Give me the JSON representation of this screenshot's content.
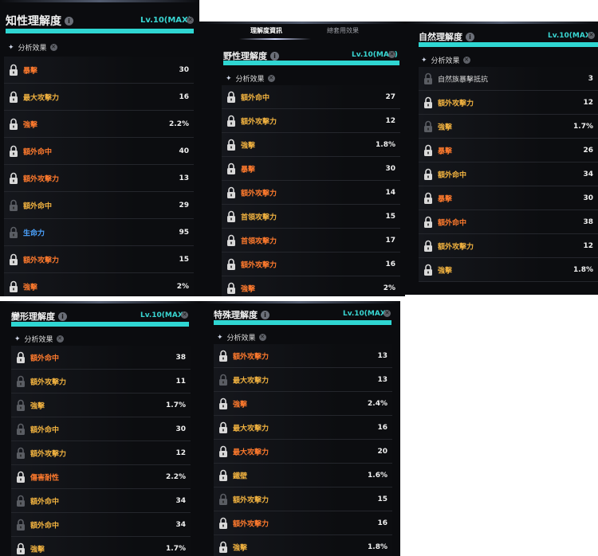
{
  "tabs": {
    "active": "理解度資訊",
    "inactive": "總套用效果"
  },
  "icons": {
    "lock": "lock-icon",
    "info": "info-icon",
    "close": "close-icon",
    "sparkle": "sparkle-icon"
  },
  "panels": [
    {
      "title": "知性理解度",
      "level": "Lv.10(MAX)",
      "subtitle": "分析效果",
      "rows": [
        {
          "label": "暴擊",
          "value": "30",
          "color": "orange",
          "unlocked": true
        },
        {
          "label": "最大攻擊力",
          "value": "16",
          "color": "yellow",
          "unlocked": true
        },
        {
          "label": "強擊",
          "value": "2.2%",
          "color": "orange",
          "unlocked": true
        },
        {
          "label": "額外命中",
          "value": "40",
          "color": "orange",
          "unlocked": true
        },
        {
          "label": "額外攻擊力",
          "value": "13",
          "color": "orange",
          "unlocked": true
        },
        {
          "label": "額外命中",
          "value": "29",
          "color": "yellow",
          "unlocked": false
        },
        {
          "label": "生命力",
          "value": "95",
          "color": "blue",
          "unlocked": false
        },
        {
          "label": "額外攻擊力",
          "value": "15",
          "color": "orange",
          "unlocked": true
        },
        {
          "label": "強擊",
          "value": "2%",
          "color": "orange",
          "unlocked": true
        }
      ]
    },
    {
      "title": "野性理解度",
      "level": "Lv.10(MAX)",
      "subtitle": "分析效果",
      "rows": [
        {
          "label": "額外命中",
          "value": "27",
          "color": "yellow",
          "unlocked": true
        },
        {
          "label": "額外攻擊力",
          "value": "12",
          "color": "yellow",
          "unlocked": true
        },
        {
          "label": "強擊",
          "value": "1.8%",
          "color": "yellow",
          "unlocked": true
        },
        {
          "label": "暴擊",
          "value": "30",
          "color": "orange",
          "unlocked": true
        },
        {
          "label": "額外攻擊力",
          "value": "14",
          "color": "orange",
          "unlocked": true
        },
        {
          "label": "首領攻擊力",
          "value": "15",
          "color": "yellow",
          "unlocked": true
        },
        {
          "label": "首領攻擊力",
          "value": "17",
          "color": "orange",
          "unlocked": true
        },
        {
          "label": "額外攻擊力",
          "value": "16",
          "color": "orange",
          "unlocked": true
        },
        {
          "label": "強擊",
          "value": "2%",
          "color": "orange",
          "unlocked": true
        }
      ]
    },
    {
      "title": "自然理解度",
      "level": "Lv.10(MAX)",
      "subtitle": "分析效果",
      "rows": [
        {
          "label": "自然族暴擊抵抗",
          "value": "3",
          "color": "white",
          "unlocked": false
        },
        {
          "label": "額外攻擊力",
          "value": "12",
          "color": "yellow",
          "unlocked": true
        },
        {
          "label": "強擊",
          "value": "1.7%",
          "color": "yellow",
          "unlocked": false
        },
        {
          "label": "暴擊",
          "value": "26",
          "color": "orange",
          "unlocked": true
        },
        {
          "label": "額外命中",
          "value": "34",
          "color": "yellow",
          "unlocked": true
        },
        {
          "label": "暴擊",
          "value": "30",
          "color": "orange",
          "unlocked": true
        },
        {
          "label": "額外命中",
          "value": "38",
          "color": "orange",
          "unlocked": true
        },
        {
          "label": "額外攻擊力",
          "value": "12",
          "color": "yellow",
          "unlocked": true
        },
        {
          "label": "強擊",
          "value": "1.8%",
          "color": "yellow",
          "unlocked": true
        }
      ]
    },
    {
      "title": "變形理解度",
      "level": "Lv.10(MAX)",
      "subtitle": "分析效果",
      "rows": [
        {
          "label": "額外命中",
          "value": "38",
          "color": "orange",
          "unlocked": true
        },
        {
          "label": "額外攻擊力",
          "value": "11",
          "color": "yellow",
          "unlocked": false
        },
        {
          "label": "強擊",
          "value": "1.7%",
          "color": "yellow",
          "unlocked": false
        },
        {
          "label": "額外命中",
          "value": "30",
          "color": "yellow",
          "unlocked": false
        },
        {
          "label": "額外攻擊力",
          "value": "12",
          "color": "yellow",
          "unlocked": false
        },
        {
          "label": "傷害耐性",
          "value": "2.2%",
          "color": "orange",
          "unlocked": true
        },
        {
          "label": "額外命中",
          "value": "34",
          "color": "yellow",
          "unlocked": false
        },
        {
          "label": "額外命中",
          "value": "34",
          "color": "yellow",
          "unlocked": false
        },
        {
          "label": "強擊",
          "value": "1.7%",
          "color": "yellow",
          "unlocked": true
        }
      ]
    },
    {
      "title": "特殊理解度",
      "level": "Lv.10(MAX)",
      "subtitle": "分析效果",
      "rows": [
        {
          "label": "額外攻擊力",
          "value": "13",
          "color": "orange",
          "unlocked": true
        },
        {
          "label": "最大攻擊力",
          "value": "13",
          "color": "yellow",
          "unlocked": false
        },
        {
          "label": "強擊",
          "value": "2.4%",
          "color": "orange",
          "unlocked": true
        },
        {
          "label": "最大攻擊力",
          "value": "16",
          "color": "yellow",
          "unlocked": true
        },
        {
          "label": "最大攻擊力",
          "value": "20",
          "color": "orange",
          "unlocked": true
        },
        {
          "label": "鐵壁",
          "value": "1.6%",
          "color": "yellow",
          "unlocked": true
        },
        {
          "label": "額外攻擊力",
          "value": "15",
          "color": "yellow",
          "unlocked": false
        },
        {
          "label": "額外攻擊力",
          "value": "16",
          "color": "orange",
          "unlocked": true
        },
        {
          "label": "強擊",
          "value": "1.8%",
          "color": "yellow",
          "unlocked": true
        }
      ]
    }
  ]
}
